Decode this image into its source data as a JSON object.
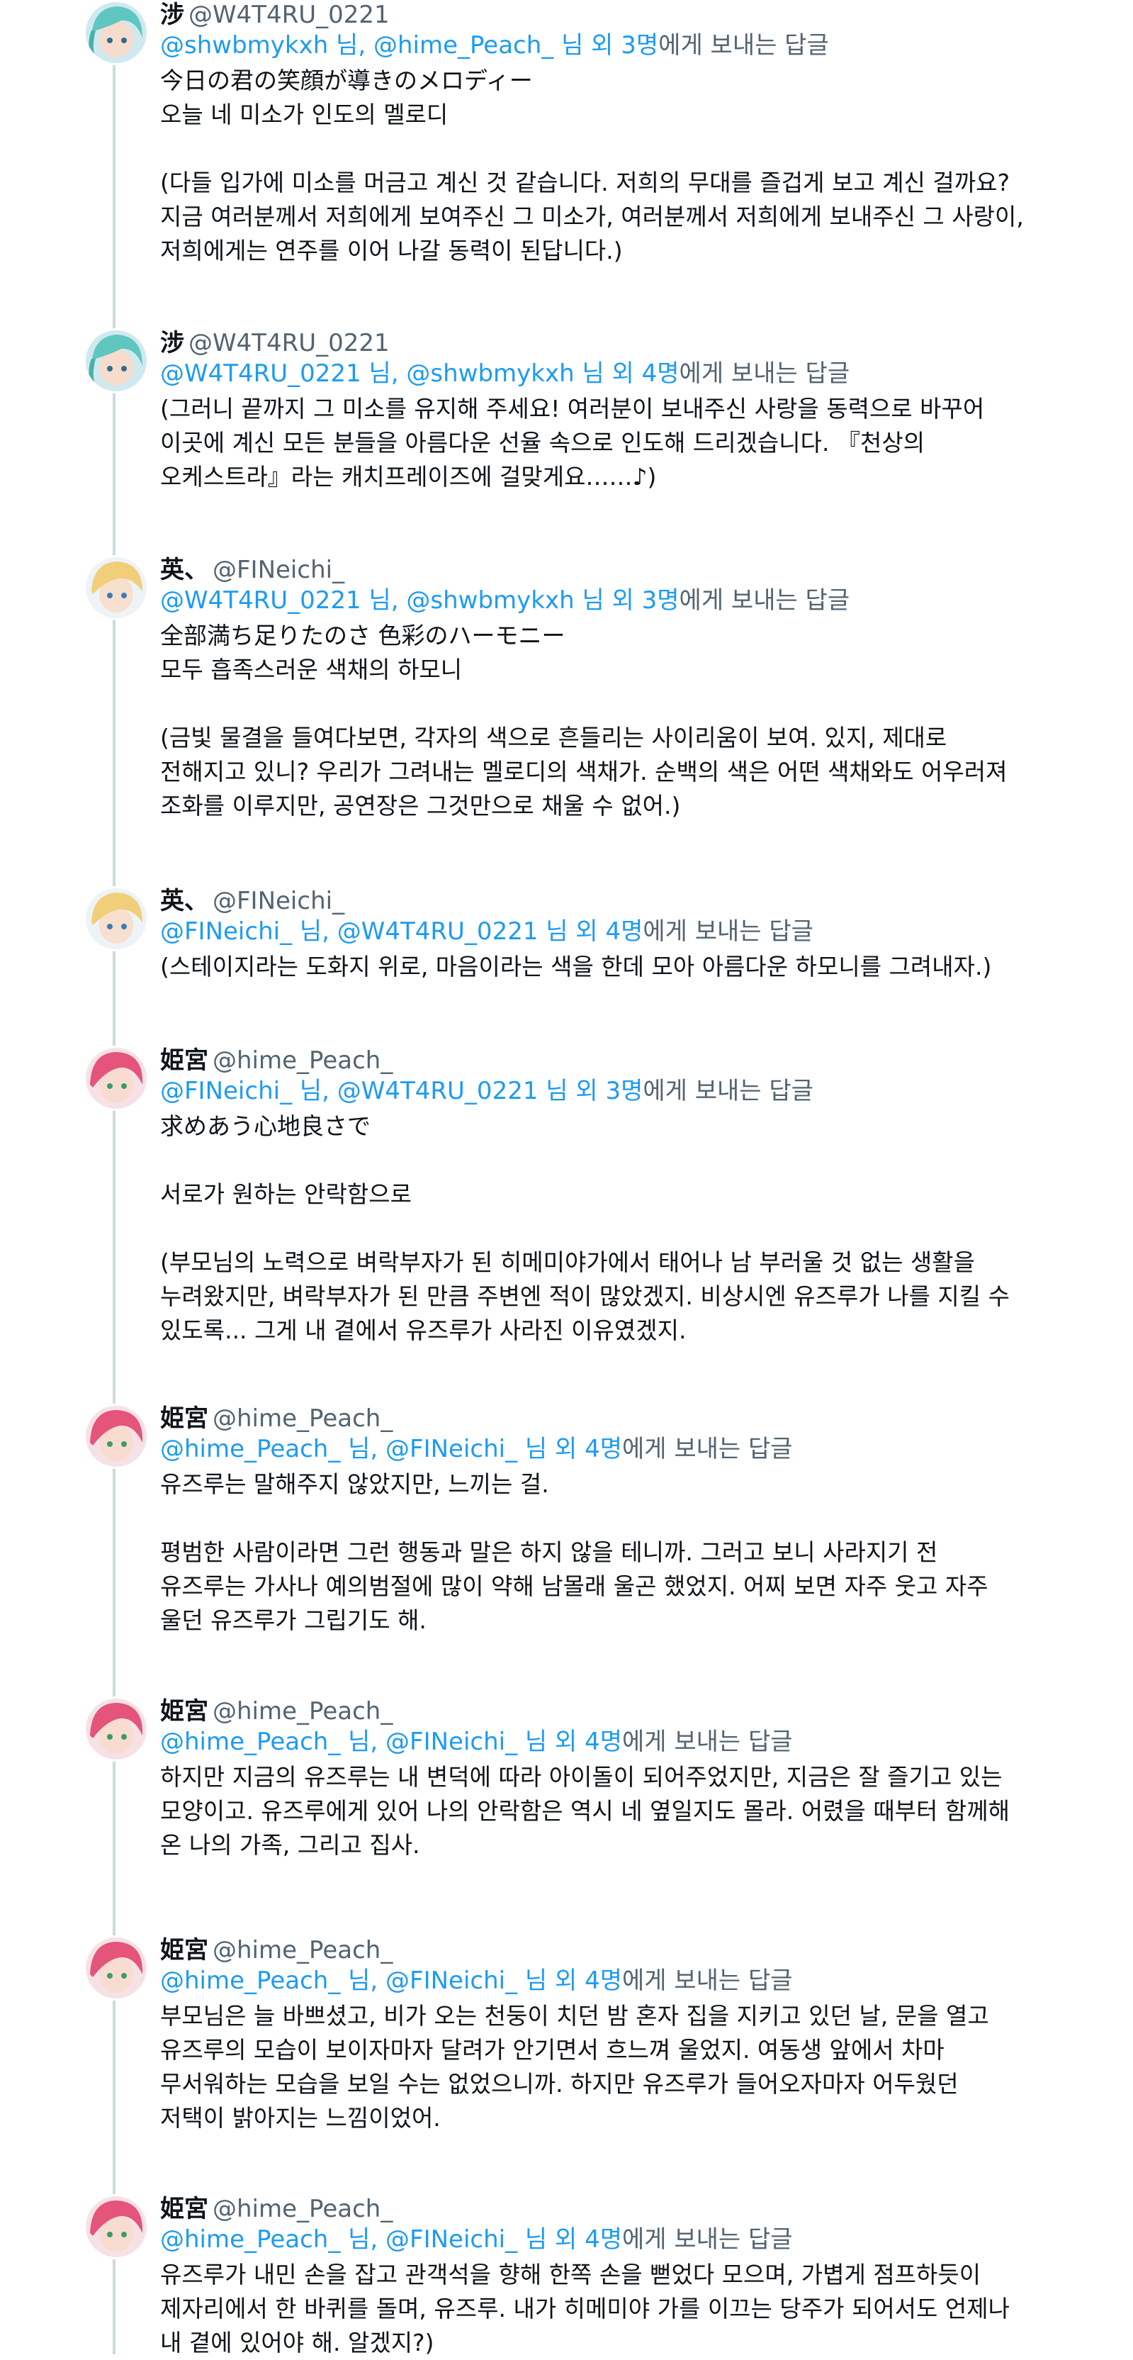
{
  "tweets": [
    {
      "name": "涉",
      "handle": "@W4T4RU_0221",
      "avatar": "teal-hair-avatar",
      "reply": {
        "mentions": "@shwbmykxh 님, @hime_Peach_ 님 외 3명",
        "suffix": "에게 보내는 답글"
      },
      "paras": [
        [
          "今日の君の笑顔が導きのメロディー",
          "오늘 네 미소가 인도의 멜로디"
        ],
        [
          "(다들 입가에 미소를 머금고 계신 것 같습니다. 저희의 무대를 즐겁게 보고 계신 걸까요?",
          "지금 여러분께서 저희에게 보여주신 그 미소가, 여러분께서 저희에게 보내주신 그 사랑이,",
          "저희에게는 연주를 이어 나갈 동력이 된답니다.)"
        ]
      ]
    },
    {
      "name": "涉",
      "handle": "@W4T4RU_0221",
      "avatar": "teal-hair-avatar",
      "reply": {
        "mentions": "@W4T4RU_0221 님, @shwbmykxh 님 외 4명",
        "suffix": "에게 보내는 답글"
      },
      "paras": [
        [
          "(그러니 끝까지 그 미소를 유지해 주세요! 여러분이 보내주신 사랑을 동력으로 바꾸어",
          "이곳에 계신 모든 분들을 아름다운 선율 속으로 인도해 드리겠습니다. 『천상의",
          "오케스트라』라는 캐치프레이즈에 걸맞게요……♪)"
        ]
      ]
    },
    {
      "name": "英、",
      "handle": "@FINeichi_",
      "avatar": "blonde-hair-avatar",
      "reply": {
        "mentions": "@W4T4RU_0221 님, @shwbmykxh 님 외 3명",
        "suffix": "에게 보내는 답글"
      },
      "paras": [
        [
          "全部満ち足りたのさ 色彩のハーモニー",
          "모두 흡족스러운 색채의 하모니"
        ],
        [
          "(금빛 물결을 들여다보면, 각자의 색으로 흔들리는 사이리움이 보여. 있지, 제대로",
          "전해지고 있니? 우리가 그려내는 멜로디의 색채가. 순백의 색은 어떤 색채와도 어우러져",
          "조화를 이루지만, 공연장은 그것만으로 채울 수 없어.)"
        ]
      ]
    },
    {
      "name": "英、",
      "handle": "@FINeichi_",
      "avatar": "blonde-hair-avatar",
      "reply": {
        "mentions": "@FINeichi_ 님, @W4T4RU_0221 님 외 4명",
        "suffix": "에게 보내는 답글"
      },
      "paras": [
        [
          "(스테이지라는 도화지 위로, 마음이라는 색을 한데 모아 아름다운 하모니를 그려내자.)"
        ]
      ]
    },
    {
      "name": "姫宮",
      "handle": "@hime_Peach_",
      "avatar": "pink-hair-avatar",
      "reply": {
        "mentions": "@FINeichi_ 님, @W4T4RU_0221 님 외 3명",
        "suffix": "에게 보내는 답글"
      },
      "paras": [
        [
          "求めあう心地良さで"
        ],
        [
          "서로가 원하는 안락함으로"
        ],
        [
          "(부모님의 노력으로 벼락부자가 된 히메미야가에서 태어나 남 부러울 것 없는 생활을",
          "누려왔지만, 벼락부자가 된 만큼 주변엔 적이 많았겠지. 비상시엔 유즈루가 나를 지킬 수",
          "있도록... 그게 내 곁에서 유즈루가 사라진 이유였겠지."
        ]
      ]
    },
    {
      "name": "姫宮",
      "handle": "@hime_Peach_",
      "avatar": "pink-hair-avatar",
      "reply": {
        "mentions": "@hime_Peach_ 님, @FINeichi_ 님 외 4명",
        "suffix": "에게 보내는 답글"
      },
      "paras": [
        [
          "유즈루는 말해주지 않았지만, 느끼는 걸."
        ],
        [
          "평범한 사람이라면 그런 행동과 말은 하지 않을 테니까. 그러고 보니 사라지기 전",
          "유즈루는 가사나 예의범절에 많이 약해 남몰래 울곤 했었지. 어찌 보면 자주 웃고 자주",
          "울던 유즈루가 그립기도 해."
        ]
      ]
    },
    {
      "name": "姫宮",
      "handle": "@hime_Peach_",
      "avatar": "pink-hair-avatar",
      "reply": {
        "mentions": "@hime_Peach_ 님, @FINeichi_ 님 외 4명",
        "suffix": "에게 보내는 답글"
      },
      "paras": [
        [
          "하지만 지금의 유즈루는 내 변덕에 따라 아이돌이 되어주었지만, 지금은 잘 즐기고 있는",
          "모양이고. 유즈루에게 있어 나의 안락함은 역시 네 옆일지도 몰라. 어렸을 때부터 함께해",
          "온 나의 가족, 그리고 집사."
        ]
      ]
    },
    {
      "name": "姫宮",
      "handle": "@hime_Peach_",
      "avatar": "pink-hair-avatar",
      "reply": {
        "mentions": "@hime_Peach_ 님, @FINeichi_ 님 외 4명",
        "suffix": "에게 보내는 답글"
      },
      "paras": [
        [
          "부모님은 늘 바쁘셨고, 비가 오는 천둥이 치던 밤 혼자 집을 지키고 있던 날, 문을 열고",
          "유즈루의 모습이 보이자마자 달려가 안기면서 흐느껴 울었지. 여동생 앞에서 차마",
          "무서워하는 모습을 보일 수는 없었으니까. 하지만 유즈루가 들어오자마자 어두웠던",
          "저택이 밝아지는 느낌이었어."
        ]
      ]
    },
    {
      "name": "姫宮",
      "handle": "@hime_Peach_",
      "avatar": "pink-hair-avatar",
      "reply": {
        "mentions": "@hime_Peach_ 님, @FINeichi_ 님 외 4명",
        "suffix": "에게 보내는 답글"
      },
      "paras": [
        [
          "유즈루가 내민 손을 잡고 관객석을 향해 한쪽 손을 뻗었다 모으며, 가볍게 점프하듯이",
          "제자리에서 한 바퀴를 돌며, 유즈루. 내가 히메미야 가를 이끄는 당주가 되어서도 언제나",
          "내 곁에 있어야 해. 알겠지?)"
        ]
      ]
    }
  ]
}
